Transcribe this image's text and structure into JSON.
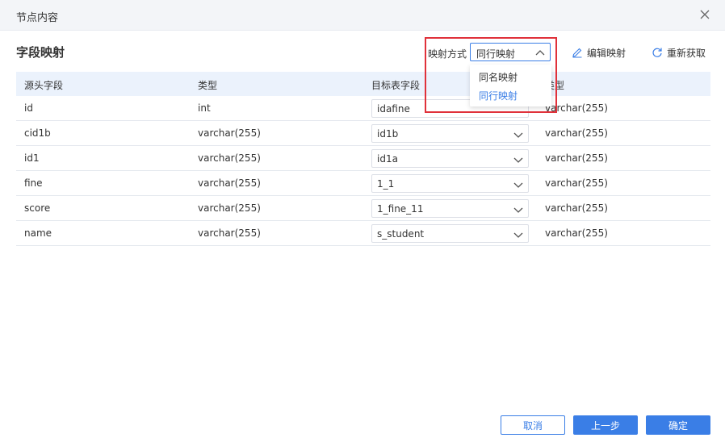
{
  "dialog": {
    "title": "节点内容"
  },
  "section": {
    "title": "字段映射"
  },
  "mapping_mode": {
    "label": "映射方式",
    "selected": "同行映射",
    "options": [
      "同名映射",
      "同行映射"
    ]
  },
  "toolbar": {
    "edit_label": "编辑映射",
    "refresh_label": "重新获取"
  },
  "table": {
    "headers": [
      "源头字段",
      "类型",
      "目标表字段",
      "类型"
    ],
    "rows": [
      {
        "source": "id",
        "source_type": "int",
        "target": "idafine",
        "target_type": "varchar(255)"
      },
      {
        "source": "cid1b",
        "source_type": "varchar(255)",
        "target": "id1b",
        "target_type": "varchar(255)"
      },
      {
        "source": "id1",
        "source_type": "varchar(255)",
        "target": "id1a",
        "target_type": "varchar(255)"
      },
      {
        "source": "fine",
        "source_type": "varchar(255)",
        "target": "1_1",
        "target_type": "varchar(255)"
      },
      {
        "source": "score",
        "source_type": "varchar(255)",
        "target": "1_fine_11",
        "target_type": "varchar(255)"
      },
      {
        "source": "name",
        "source_type": "varchar(255)",
        "target": "s_student",
        "target_type": "varchar(255)"
      }
    ]
  },
  "footer": {
    "cancel_label": "取消",
    "prev_label": "上一步",
    "confirm_label": "确定"
  },
  "colors": {
    "accent": "#3a7ee6",
    "highlight": "#e0313a",
    "header_bg": "#ebf2fc"
  }
}
